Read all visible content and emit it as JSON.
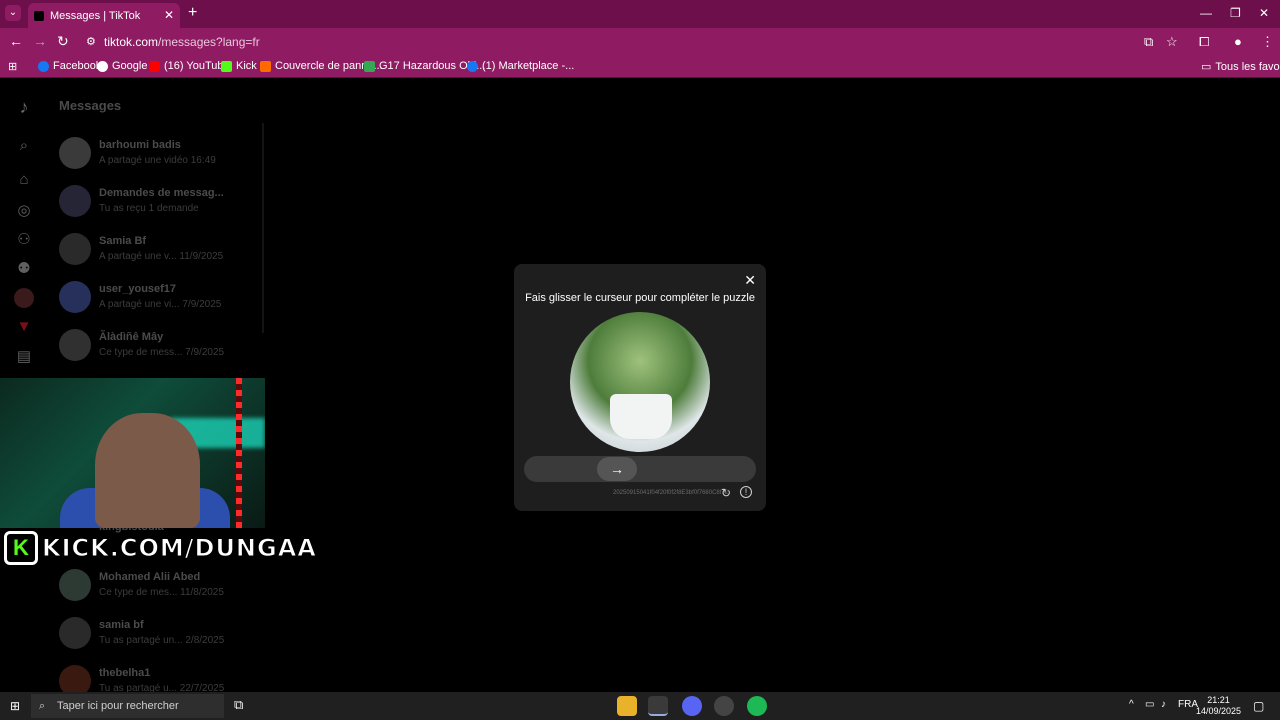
{
  "browser": {
    "tab_title": "Messages | TikTok",
    "url_domain": "tiktok.com",
    "url_path": "/messages?lang=fr",
    "bookmarks": [
      "Facebook",
      "Google",
      "(16) YouTube",
      "Kick",
      "Couvercle de panne...",
      "G17 Hazardous Obj...",
      "(1) Marketplace -..."
    ],
    "all_bookmarks_label": "Tous les favoris"
  },
  "messages": {
    "title": "Messages",
    "conversations": [
      {
        "name": "barhoumi badis",
        "preview": "A partagé une vidéo 16:49"
      },
      {
        "name": "Demandes de messag...",
        "preview": "Tu as reçu 1 demande"
      },
      {
        "name": "Samia Bf",
        "preview": "A partagé une v... 11/9/2025"
      },
      {
        "name": "user_yousef17",
        "preview": "A partagé une vi... 7/9/2025"
      },
      {
        "name": "Ãlàdìñê Mây",
        "preview": "Ce type de mess... 7/9/2025"
      },
      {
        "name": "kingbistoula",
        "preview": ""
      },
      {
        "name": "Mohamed Alii Abed",
        "preview": "Ce type de mes... 11/8/2025"
      },
      {
        "name": "samia bf",
        "preview": "Tu as partagé un... 2/8/2025"
      },
      {
        "name": "thebelha1",
        "preview": "Tu as partagé u... 22/7/2025"
      }
    ]
  },
  "overlay": {
    "kick_text": "KICK.COM/DUNGAA",
    "kick_logo": "K"
  },
  "captcha": {
    "title": "Fais glisser le curseur pour compléter le puzzle",
    "id_text": "20250915041f04f20f0f2f8E3bf0f7680C8f72",
    "slider_progress": 0.38
  },
  "taskbar": {
    "search_placeholder": "Taper ici pour rechercher",
    "lang": "FRA",
    "time": "21:21",
    "date": "14/09/2025"
  }
}
